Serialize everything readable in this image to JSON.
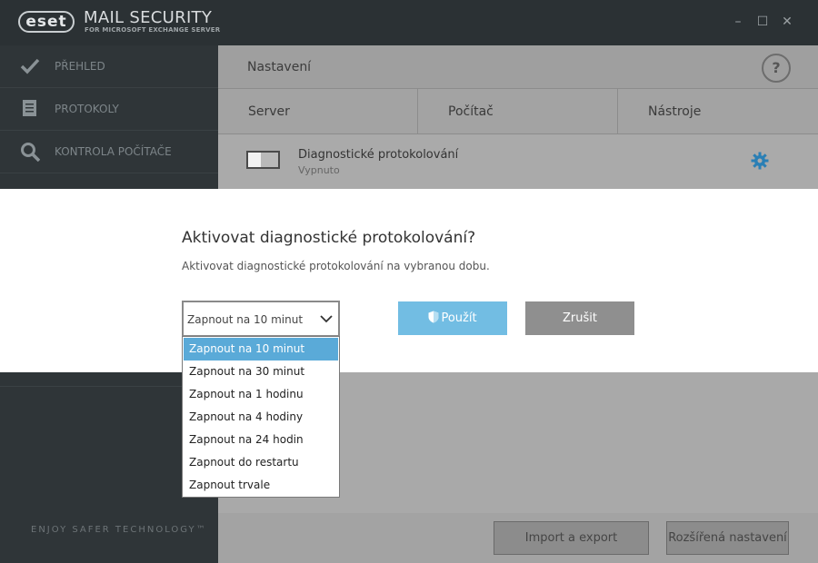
{
  "titlebar": {
    "logo": "eset",
    "product": "MAIL SECURITY",
    "subtitle": "FOR MICROSOFT EXCHANGE SERVER",
    "minimize": "–",
    "maximize": "☐",
    "close": "✕"
  },
  "sidebar": {
    "items": [
      {
        "label": "PŘEHLED",
        "icon": "check-icon"
      },
      {
        "label": "PROTOKOLY",
        "icon": "log-icon"
      },
      {
        "label": "KONTROLA POČÍTAČE",
        "icon": "search-icon"
      }
    ],
    "tagline": "ENJOY SAFER TECHNOLOGY™"
  },
  "main": {
    "title": "Nastavení",
    "help": "?",
    "tabs": [
      "Server",
      "Počítač",
      "Nástroje"
    ],
    "diagnostic": {
      "title": "Diagnostické protokolování",
      "state": "Vypnuto"
    },
    "buttons": {
      "import_export": "Import a export nastavení",
      "advanced": "Rozšířená nastavení"
    }
  },
  "modal": {
    "title": "Aktivovat diagnostické protokolování?",
    "description": "Aktivovat diagnostické protokolování na vybranou dobu.",
    "selected": "Zapnout na 10 minut",
    "apply": "Použít",
    "cancel": "Zrušit",
    "options": [
      "Zapnout na 10 minut",
      "Zapnout na 30 minut",
      "Zapnout na 1 hodinu",
      "Zapnout na 4 hodiny",
      "Zapnout na 24 hodin",
      "Zapnout do restartu",
      "Zapnout trvale"
    ]
  },
  "colors": {
    "accent": "#72bde3",
    "selected_option": "#5aaad8",
    "sidebar": "#2f3538",
    "gear": "#2a7fb5"
  }
}
